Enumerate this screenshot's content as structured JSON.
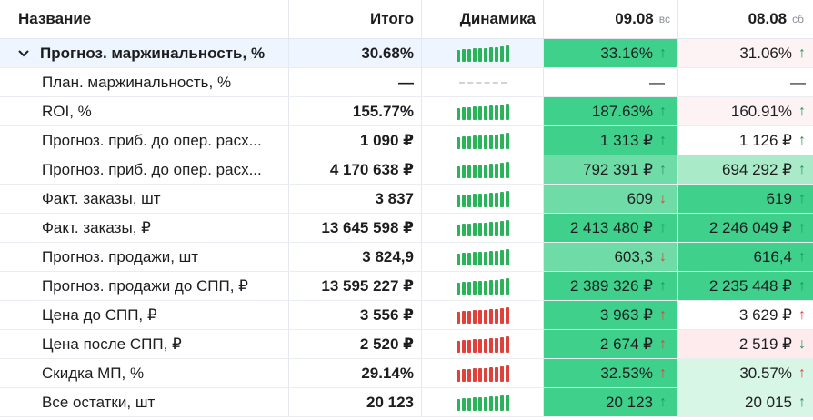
{
  "header": {
    "name": "Название",
    "total": "Итого",
    "dynamics": "Динамика",
    "date1": "09.08",
    "date1_dow": "вс",
    "date2": "08.08",
    "date2_dow": "сб"
  },
  "colors": {
    "green_strong": "#3fd08c",
    "green_mid": "#6fdca7",
    "green_light": "#a9ebc8",
    "green_faint": "#d7f6e6",
    "red_faint": "#fdebed",
    "red_softer": "#fdf3f4",
    "spark_green": "#2bb35a",
    "spark_red": "#e0413b",
    "arrow_green": "#1a9a52",
    "arrow_red": "#e0413b"
  },
  "rows": [
    {
      "name": "Прогноз. маржинальность, %",
      "total": "30.68%",
      "total_bold": false,
      "spark": "green",
      "d1": "33.16%",
      "d1_arrow": "↑",
      "d1_arrow_color": "green",
      "d1_bg": "#3fd08c",
      "d2": "31.06%",
      "d2_arrow": "↑",
      "d2_arrow_color": "green",
      "d2_bg": "#fdf3f4"
    },
    {
      "name": "План. маржинальность, %",
      "total": "—",
      "total_bold": false,
      "spark": "none",
      "d1": "—",
      "d1_arrow": "",
      "d1_arrow_color": "",
      "d1_bg": "#ffffff",
      "d2": "—",
      "d2_arrow": "",
      "d2_arrow_color": "",
      "d2_bg": "#ffffff"
    },
    {
      "name": "ROI, %",
      "total": "155.77%",
      "total_bold": true,
      "spark": "green",
      "d1": "187.63%",
      "d1_arrow": "↑",
      "d1_arrow_color": "green",
      "d1_bg": "#3fd08c",
      "d2": "160.91%",
      "d2_arrow": "↑",
      "d2_arrow_color": "green",
      "d2_bg": "#fdf3f4"
    },
    {
      "name": "Прогноз. приб. до опер. расх...",
      "total": "1 090 ₽",
      "total_bold": true,
      "spark": "green",
      "d1": "1 313 ₽",
      "d1_arrow": "↑",
      "d1_arrow_color": "green",
      "d1_bg": "#3fd08c",
      "d2": "1 126 ₽",
      "d2_arrow": "↑",
      "d2_arrow_color": "green",
      "d2_bg": "#ffffff"
    },
    {
      "name": "Прогноз. приб. до опер. расх...",
      "total": "4 170 638 ₽",
      "total_bold": true,
      "spark": "green",
      "d1": "792 391 ₽",
      "d1_arrow": "↑",
      "d1_arrow_color": "green",
      "d1_bg": "#6fdca7",
      "d2": "694 292 ₽",
      "d2_arrow": "↑",
      "d2_arrow_color": "green",
      "d2_bg": "#a9ebc8"
    },
    {
      "name": "Факт. заказы, шт",
      "total": "3 837",
      "total_bold": true,
      "spark": "green",
      "d1": "609",
      "d1_arrow": "↓",
      "d1_arrow_color": "red",
      "d1_bg": "#6fdca7",
      "d2": "619",
      "d2_arrow": "↑",
      "d2_arrow_color": "green",
      "d2_bg": "#3fd08c"
    },
    {
      "name": "Факт. заказы, ₽",
      "total": "13 645 598 ₽",
      "total_bold": true,
      "spark": "green",
      "d1": "2 413 480 ₽",
      "d1_arrow": "↑",
      "d1_arrow_color": "green",
      "d1_bg": "#3fd08c",
      "d2": "2 246 049 ₽",
      "d2_arrow": "↑",
      "d2_arrow_color": "green",
      "d2_bg": "#3fd08c"
    },
    {
      "name": "Прогноз. продажи, шт",
      "total": "3 824,9",
      "total_bold": true,
      "spark": "green",
      "d1": "603,3",
      "d1_arrow": "↓",
      "d1_arrow_color": "red",
      "d1_bg": "#6fdca7",
      "d2": "616,4",
      "d2_arrow": "↑",
      "d2_arrow_color": "green",
      "d2_bg": "#3fd08c"
    },
    {
      "name": "Прогноз. продажи до СПП, ₽",
      "total": "13 595 227 ₽",
      "total_bold": true,
      "spark": "green",
      "d1": "2 389 326 ₽",
      "d1_arrow": "↑",
      "d1_arrow_color": "green",
      "d1_bg": "#3fd08c",
      "d2": "2 235 448 ₽",
      "d2_arrow": "↑",
      "d2_arrow_color": "green",
      "d2_bg": "#3fd08c"
    },
    {
      "name": "Цена до СПП, ₽",
      "total": "3 556 ₽",
      "total_bold": true,
      "spark": "red",
      "d1": "3 963 ₽",
      "d1_arrow": "↑",
      "d1_arrow_color": "red",
      "d1_bg": "#3fd08c",
      "d2": "3 629 ₽",
      "d2_arrow": "↑",
      "d2_arrow_color": "red",
      "d2_bg": "#ffffff"
    },
    {
      "name": "Цена после СПП, ₽",
      "total": "2 520 ₽",
      "total_bold": true,
      "spark": "red",
      "d1": "2 674 ₽",
      "d1_arrow": "↑",
      "d1_arrow_color": "red",
      "d1_bg": "#3fd08c",
      "d2": "2 519 ₽",
      "d2_arrow": "↓",
      "d2_arrow_color": "green",
      "d2_bg": "#fdebed"
    },
    {
      "name": "Скидка МП, %",
      "total": "29.14%",
      "total_bold": true,
      "spark": "red",
      "d1": "32.53%",
      "d1_arrow": "↑",
      "d1_arrow_color": "red",
      "d1_bg": "#3fd08c",
      "d2": "30.57%",
      "d2_arrow": "↑",
      "d2_arrow_color": "red",
      "d2_bg": "#d7f6e6"
    },
    {
      "name": "Все остатки, шт",
      "total": "20 123",
      "total_bold": true,
      "spark": "green",
      "d1": "20 123",
      "d1_arrow": "↑",
      "d1_arrow_color": "green",
      "d1_bg": "#3fd08c",
      "d2": "20 015",
      "d2_arrow": "↑",
      "d2_arrow_color": "green",
      "d2_bg": "#d7f6e6"
    }
  ]
}
